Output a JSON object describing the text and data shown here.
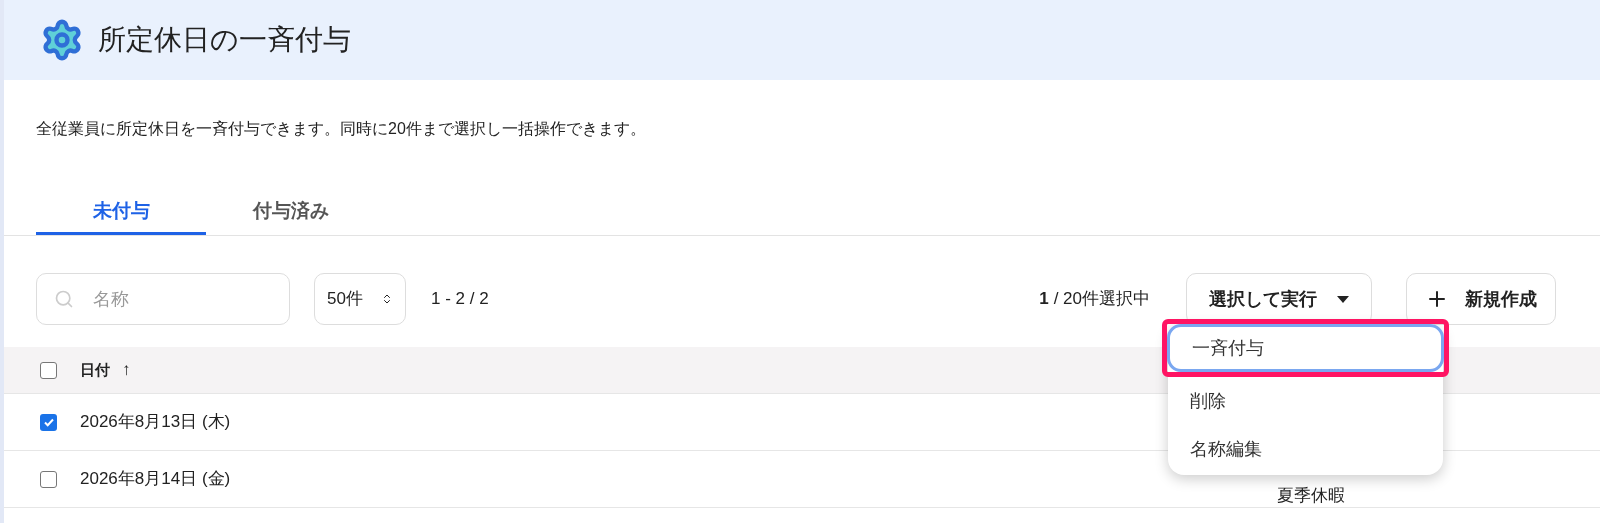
{
  "header": {
    "title": "所定休日の一斉付与"
  },
  "description": "全従業員に所定休日を一斉付与できます。同時に20件まで選択し一括操作できます。",
  "tabs": [
    {
      "label": "未付与",
      "selected": true
    },
    {
      "label": "付与済み",
      "selected": false
    }
  ],
  "toolbar": {
    "search": {
      "placeholder": "名称"
    },
    "page_size": "50件",
    "range": "1 - 2 / 2",
    "selection_count": "1",
    "selection_total": "/ 20件選択中",
    "action_button": "選択して実行",
    "new_button": "新規作成"
  },
  "menu": [
    {
      "label": "一斉付与",
      "highlighted": true
    },
    {
      "label": "削除",
      "highlighted": false
    },
    {
      "label": "名称編集",
      "highlighted": false
    }
  ],
  "table": {
    "header": {
      "checked": false,
      "column_1": "日付",
      "sort": "↑"
    },
    "rows": [
      {
        "checked": true,
        "column_1": "2026年8月13日 (木)"
      },
      {
        "checked": false,
        "column_1": "2026年8月14日 (金)",
        "column_2": "夏季休暇"
      }
    ]
  }
}
